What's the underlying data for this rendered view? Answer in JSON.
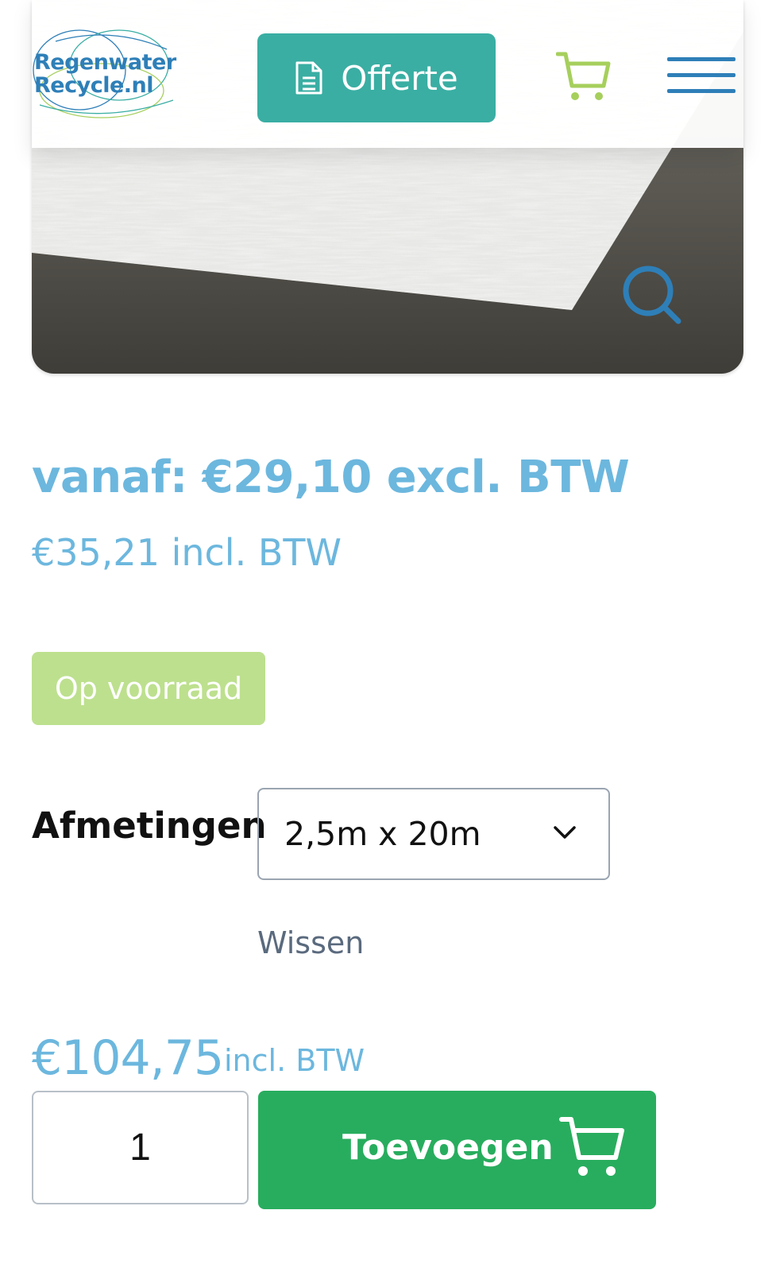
{
  "header": {
    "logo_line1": "Regenwater",
    "logo_line2": "Recycle.nl",
    "offerte_label": "Offerte"
  },
  "product": {
    "price_from": "vanaf: €29,10 excl. BTW",
    "price_incl": "€35,21 incl. BTW",
    "stock_status": "Op voorraad",
    "dimensions_label": "Afmetingen",
    "dimensions_value": "2,5m x 20m",
    "clear_label": "Wissen",
    "total_price": "€104,75",
    "total_suffix": "incl. BTW",
    "quantity": "1",
    "add_label": "Toevoegen"
  },
  "colors": {
    "teal": "#3aaea3",
    "brand_blue": "#2e7fb8",
    "price_blue": "#6cb7de",
    "stock_green": "#bde08e",
    "cart_green": "#28ad5e",
    "lime": "#a6cf5c"
  },
  "icons": [
    "document-icon",
    "cart-icon",
    "menu-icon",
    "search-icon",
    "chevron-down-icon"
  ]
}
